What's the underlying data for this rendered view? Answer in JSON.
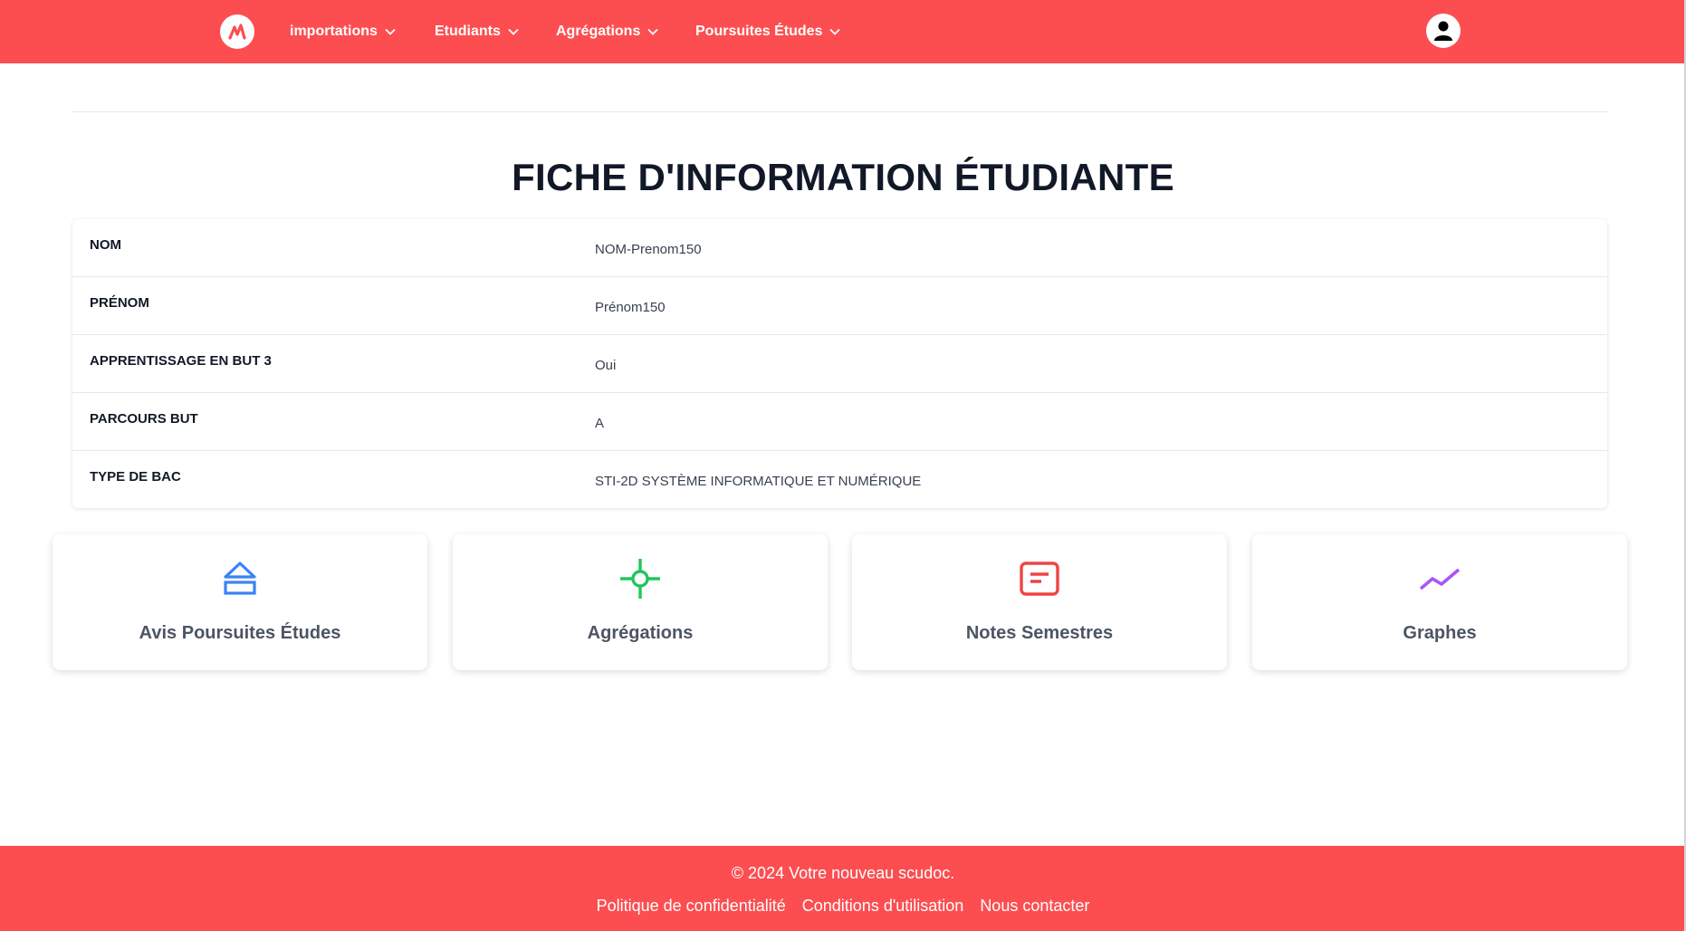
{
  "nav": {
    "logo_icon": "m-logo-icon",
    "items": [
      {
        "label": "importations"
      },
      {
        "label": "Etudiants"
      },
      {
        "label": "Agrégations"
      },
      {
        "label": "Poursuites Études"
      }
    ],
    "avatar_icon": "user-icon"
  },
  "page": {
    "title": "FICHE D'INFORMATION ÉTUDIANTE"
  },
  "student": {
    "rows": [
      {
        "label": "NOM",
        "value": "NOM-Prenom150"
      },
      {
        "label": "PRÉNOM",
        "value": "Prénom150"
      },
      {
        "label": "APPRENTISSAGE EN BUT 3",
        "value": "Oui"
      },
      {
        "label": "PARCOURS BUT",
        "value": "A"
      },
      {
        "label": "TYPE DE BAC",
        "value": "STI-2D SYSTÈME INFORMATIQUE ET NUMÉRIQUE"
      }
    ]
  },
  "actions": [
    {
      "label": "Avis Poursuites Études",
      "icon": "eject-icon",
      "color": "#3b82f6"
    },
    {
      "label": "Agrégations",
      "icon": "crosshair-icon",
      "color": "#22c55e"
    },
    {
      "label": "Notes Semestres",
      "icon": "note-icon",
      "color": "#ef4444"
    },
    {
      "label": "Graphes",
      "icon": "trend-icon",
      "color": "#a855f7"
    }
  ],
  "footer": {
    "copyright": "© 2024 Votre nouveau scudoc.",
    "links": [
      "Politique de confidentialité",
      "Conditions d'utilisation",
      "Nous contacter"
    ]
  },
  "colors": {
    "brand": "#fc4e51"
  }
}
